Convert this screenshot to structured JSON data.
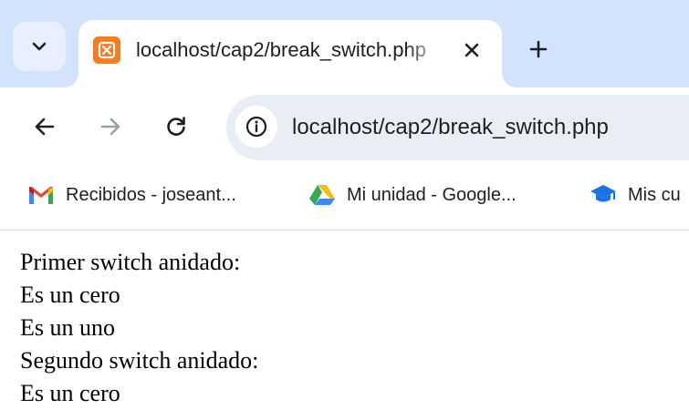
{
  "browser": {
    "tab": {
      "title": "localhost/cap2/break_switch.php"
    },
    "address_bar": {
      "url": "localhost/cap2/break_switch.php"
    },
    "bookmarks": [
      {
        "label": "Recibidos - joseant...",
        "icon": "gmail-icon"
      },
      {
        "label": "Mi unidad - Google...",
        "icon": "google-drive-icon"
      },
      {
        "label": "Mis cu",
        "icon": "graduation-cap-icon"
      }
    ],
    "colors": {
      "tabstrip": "#d3e3fd",
      "omnibox": "#e9eef6",
      "favicon": "#f57c21"
    }
  },
  "page": {
    "lines": [
      "Primer switch anidado:",
      "Es un cero",
      "Es un uno",
      "Segundo switch anidado:",
      "Es un cero"
    ]
  }
}
